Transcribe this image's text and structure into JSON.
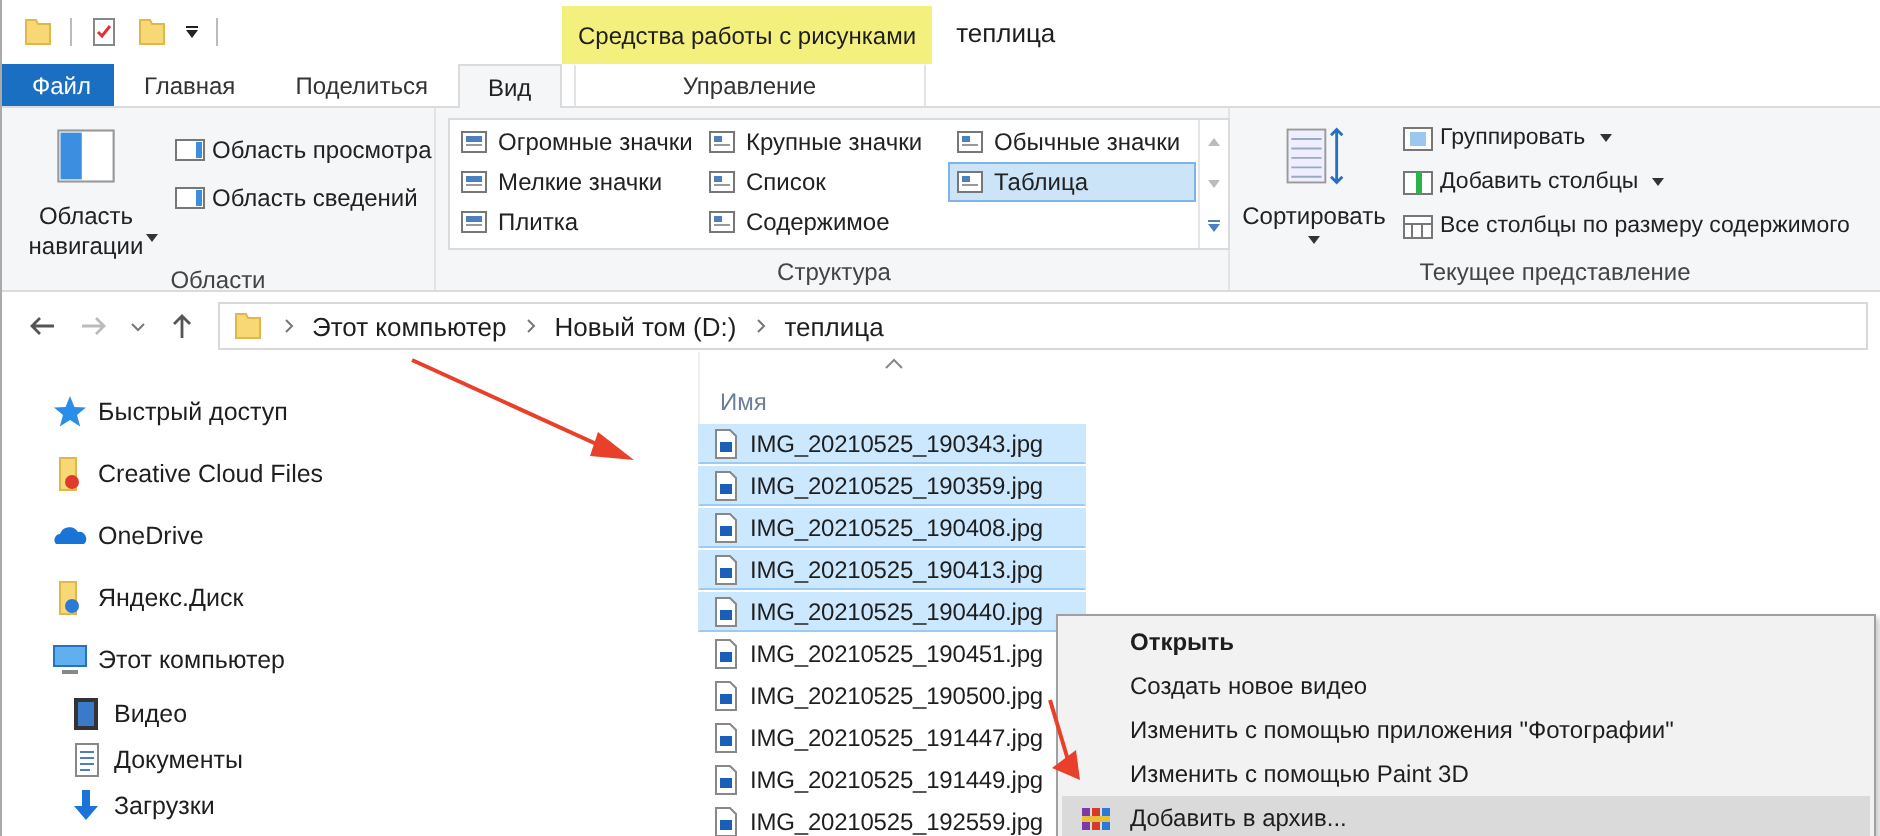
{
  "title_bar": {
    "context_tab": "Средства работы с рисунками",
    "title": "теплица"
  },
  "tabs": [
    {
      "label": "Файл",
      "kind": "file",
      "selected": false
    },
    {
      "label": "Главная",
      "kind": "tab",
      "selected": false
    },
    {
      "label": "Поделиться",
      "kind": "tab",
      "selected": false
    },
    {
      "label": "Вид",
      "kind": "tab",
      "selected": true
    },
    {
      "label": "Управление",
      "kind": "context",
      "selected": false
    }
  ],
  "ribbon": {
    "panes": {
      "big_button": "Область навигации",
      "buttons": [
        "Область просмотра",
        "Область сведений"
      ],
      "group": "Области"
    },
    "layout": {
      "items": [
        {
          "label": "Огромные значки",
          "selected": false
        },
        {
          "label": "Крупные значки",
          "selected": false
        },
        {
          "label": "Обычные значки",
          "selected": false
        },
        {
          "label": "Мелкие значки",
          "selected": false
        },
        {
          "label": "Список",
          "selected": false
        },
        {
          "label": "Таблица",
          "selected": true
        },
        {
          "label": "Плитка",
          "selected": false
        },
        {
          "label": "Содержимое",
          "selected": false
        }
      ],
      "group": "Структура"
    },
    "current_view": {
      "big_button": "Сортировать",
      "buttons": [
        {
          "label": "Группировать",
          "dropdown": true
        },
        {
          "label": "Добавить столбцы",
          "dropdown": true
        },
        {
          "label": "Все столбцы по размеру содержимого",
          "dropdown": false
        }
      ],
      "group": "Текущее представление"
    }
  },
  "address_bar": {
    "path": [
      "Этот компьютер",
      "Новый том (D:)",
      "теплица"
    ]
  },
  "nav_pane": [
    {
      "label": "Быстрый доступ"
    },
    {
      "label": "Creative Cloud Files"
    },
    {
      "label": "OneDrive"
    },
    {
      "label": "Яндекс.Диск"
    },
    {
      "label": "Этот компьютер",
      "children": [
        {
          "label": "Видео"
        },
        {
          "label": "Документы"
        },
        {
          "label": "Загрузки"
        }
      ]
    }
  ],
  "file_list": {
    "column": "Имя",
    "files": [
      {
        "name": "IMG_20210525_190343.jpg",
        "selected": true
      },
      {
        "name": "IMG_20210525_190359.jpg",
        "selected": true
      },
      {
        "name": "IMG_20210525_190408.jpg",
        "selected": true
      },
      {
        "name": "IMG_20210525_190413.jpg",
        "selected": true
      },
      {
        "name": "IMG_20210525_190440.jpg",
        "selected": true
      },
      {
        "name": "IMG_20210525_190451.jpg",
        "selected": false
      },
      {
        "name": "IMG_20210525_190500.jpg",
        "selected": false
      },
      {
        "name": "IMG_20210525_191447.jpg",
        "selected": false
      },
      {
        "name": "IMG_20210525_191449.jpg",
        "selected": false
      },
      {
        "name": "IMG_20210525_192559.jpg",
        "selected": false
      }
    ]
  },
  "context_menu": [
    {
      "label": "Открыть",
      "default": true,
      "highlighted": false
    },
    {
      "label": "Создать новое видео",
      "default": false,
      "highlighted": false
    },
    {
      "label": "Изменить с помощью приложения \"Фотографии\"",
      "default": false,
      "highlighted": false
    },
    {
      "label": "Изменить с помощью Paint 3D",
      "default": false,
      "highlighted": false
    },
    {
      "label": "Добавить в архив...",
      "default": false,
      "highlighted": true
    }
  ]
}
